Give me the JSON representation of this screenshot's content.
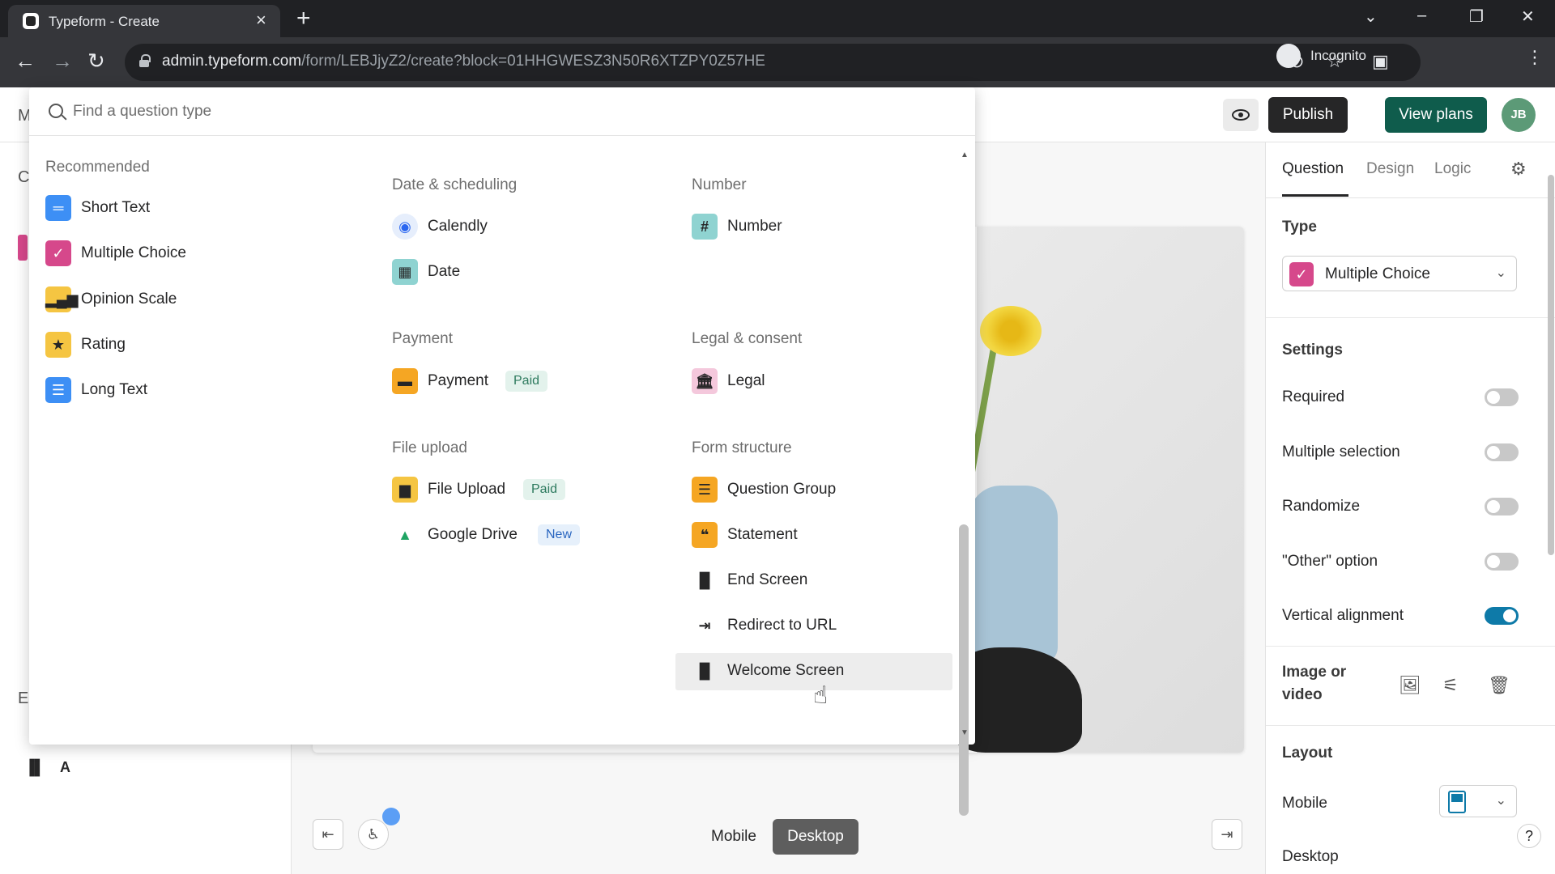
{
  "browser": {
    "tab_title": "Typeform - Create",
    "url_host": "admin.typeform.com",
    "url_path": "/form/LEBJjyZ2/create?block=01HHGWESZ3N50R6XTZPY0Z57HE",
    "profile_label": "Incognito"
  },
  "header": {
    "publish_label": "Publish",
    "view_plans_label": "View plans",
    "avatar_initials": "JB"
  },
  "left_strip": {
    "frag_top": "M",
    "frag_mid": "C",
    "frag_bottom": "E",
    "bottom_letter": "A"
  },
  "picker": {
    "search_placeholder": "Find a question type",
    "recommended": {
      "title": "Recommended",
      "items": [
        {
          "label": "Short Text",
          "color": "#3d8ff5",
          "icon": "short-text-icon"
        },
        {
          "label": "Multiple Choice",
          "color": "#d6488b",
          "icon": "check-icon"
        },
        {
          "label": "Opinion Scale",
          "color": "#f5c542",
          "icon": "bar-chart-icon"
        },
        {
          "label": "Rating",
          "color": "#f5c542",
          "icon": "star-icon"
        },
        {
          "label": "Long Text",
          "color": "#3d8ff5",
          "icon": "long-text-icon"
        }
      ]
    },
    "date_scheduling": {
      "title": "Date & scheduling",
      "items": [
        {
          "label": "Calendly"
        },
        {
          "label": "Date"
        }
      ]
    },
    "payment": {
      "title": "Payment",
      "items": [
        {
          "label": "Payment",
          "badge": "Paid"
        }
      ]
    },
    "file_upload": {
      "title": "File upload",
      "items": [
        {
          "label": "File Upload",
          "badge": "Paid"
        },
        {
          "label": "Google Drive",
          "badge": "New"
        }
      ]
    },
    "number": {
      "title": "Number",
      "items": [
        {
          "label": "Number"
        }
      ]
    },
    "legal": {
      "title": "Legal & consent",
      "items": [
        {
          "label": "Legal"
        }
      ]
    },
    "form_structure": {
      "title": "Form structure",
      "items": [
        {
          "label": "Question Group"
        },
        {
          "label": "Statement"
        },
        {
          "label": "End Screen"
        },
        {
          "label": "Redirect to URL"
        },
        {
          "label": "Welcome Screen"
        }
      ]
    }
  },
  "canvas": {
    "device_mobile": "Mobile",
    "device_desktop": "Desktop"
  },
  "right_panel": {
    "tabs": [
      "Question",
      "Design",
      "Logic"
    ],
    "type_label": "Type",
    "type_value": "Multiple Choice",
    "settings_label": "Settings",
    "toggles": [
      {
        "label": "Required",
        "on": false
      },
      {
        "label": "Multiple selection",
        "on": false
      },
      {
        "label": "Randomize",
        "on": false
      },
      {
        "label": "\"Other\" option",
        "on": false
      },
      {
        "label": "Vertical alignment",
        "on": true
      }
    ],
    "image_or_video_line1": "Image or",
    "image_or_video_line2": "video",
    "layout_label": "Layout",
    "layout_mobile": "Mobile",
    "layout_desktop": "Desktop",
    "help": "?"
  }
}
